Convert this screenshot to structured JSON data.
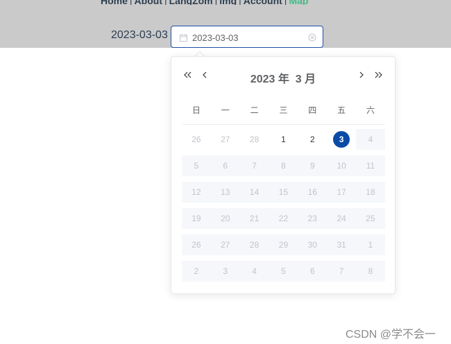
{
  "nav": {
    "links": [
      {
        "label": "Home",
        "active": false
      },
      {
        "label": "About",
        "active": false
      },
      {
        "label": "LangZom",
        "active": false
      },
      {
        "label": "img",
        "active": false
      },
      {
        "label": "Account",
        "active": false
      },
      {
        "label": "Map",
        "active": true
      }
    ]
  },
  "date_label": "2023-03-03",
  "date_input": {
    "value": "2023-03-03",
    "placeholder": ""
  },
  "picker": {
    "year_text": "2023 年",
    "month_text": "3 月",
    "weekdays": [
      "日",
      "一",
      "二",
      "三",
      "四",
      "五",
      "六"
    ],
    "weeks": [
      [
        {
          "d": "26",
          "t": "prev"
        },
        {
          "d": "27",
          "t": "prev"
        },
        {
          "d": "28",
          "t": "prev"
        },
        {
          "d": "1",
          "t": "avail"
        },
        {
          "d": "2",
          "t": "avail"
        },
        {
          "d": "3",
          "t": "current"
        },
        {
          "d": "4",
          "t": "disabled"
        }
      ],
      [
        {
          "d": "5",
          "t": "disabled"
        },
        {
          "d": "6",
          "t": "disabled"
        },
        {
          "d": "7",
          "t": "disabled"
        },
        {
          "d": "8",
          "t": "disabled"
        },
        {
          "d": "9",
          "t": "disabled"
        },
        {
          "d": "10",
          "t": "disabled"
        },
        {
          "d": "11",
          "t": "disabled"
        }
      ],
      [
        {
          "d": "12",
          "t": "disabled"
        },
        {
          "d": "13",
          "t": "disabled"
        },
        {
          "d": "14",
          "t": "disabled"
        },
        {
          "d": "15",
          "t": "disabled"
        },
        {
          "d": "16",
          "t": "disabled"
        },
        {
          "d": "17",
          "t": "disabled"
        },
        {
          "d": "18",
          "t": "disabled"
        }
      ],
      [
        {
          "d": "19",
          "t": "disabled"
        },
        {
          "d": "20",
          "t": "disabled"
        },
        {
          "d": "21",
          "t": "disabled"
        },
        {
          "d": "22",
          "t": "disabled"
        },
        {
          "d": "23",
          "t": "disabled"
        },
        {
          "d": "24",
          "t": "disabled"
        },
        {
          "d": "25",
          "t": "disabled"
        }
      ],
      [
        {
          "d": "26",
          "t": "disabled"
        },
        {
          "d": "27",
          "t": "disabled"
        },
        {
          "d": "28",
          "t": "disabled"
        },
        {
          "d": "29",
          "t": "disabled"
        },
        {
          "d": "30",
          "t": "disabled"
        },
        {
          "d": "31",
          "t": "disabled"
        },
        {
          "d": "1",
          "t": "disabled"
        }
      ],
      [
        {
          "d": "2",
          "t": "disabled"
        },
        {
          "d": "3",
          "t": "disabled"
        },
        {
          "d": "4",
          "t": "disabled"
        },
        {
          "d": "5",
          "t": "disabled"
        },
        {
          "d": "6",
          "t": "disabled"
        },
        {
          "d": "7",
          "t": "disabled"
        },
        {
          "d": "8",
          "t": "disabled"
        }
      ]
    ]
  },
  "icons": {
    "date_input_prefix": "calendar-icon",
    "date_input_suffix": "circle-close-icon",
    "prev_year": "double-chevron-left-icon",
    "prev_month": "chevron-left-icon",
    "next_month": "chevron-right-icon",
    "next_year": "double-chevron-right-icon"
  },
  "colors": {
    "header_bg": "#cacaca",
    "nav_active": "#42b983",
    "input_focus_border": "#1c4fa8",
    "selected_day": "#0a4ba6",
    "disabled_cell_bg": "#f5f7fa"
  },
  "watermark": "CSDN @学不会一"
}
